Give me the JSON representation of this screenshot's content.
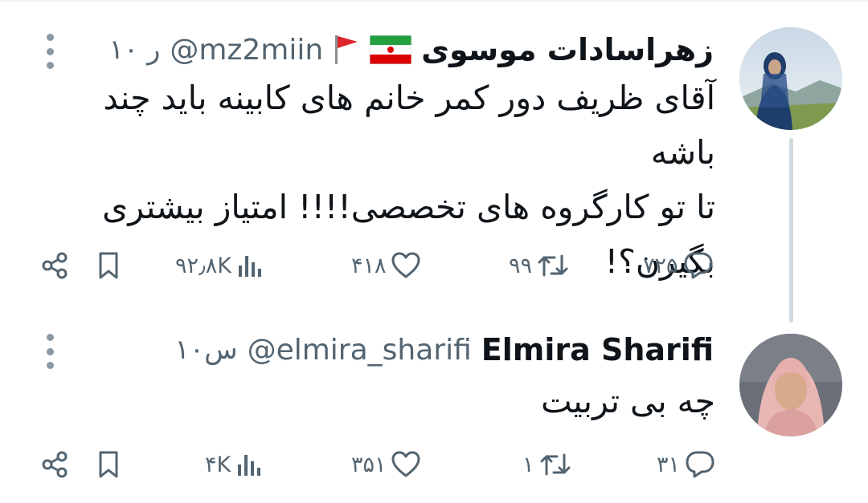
{
  "tweets": [
    {
      "author_name": "زهراسادات موسوی",
      "flag_icons": [
        "iran-flag-icon",
        "red-flag-icon"
      ],
      "handle": "@mz2miin",
      "time": "۱۰ ر",
      "text_lines": [
        "آقای ظریف دور کمر خانم های کابینه باید چند باشه",
        "تا تو کارگروه های تخصصی!!!! امتیاز بیشتری",
        "بگیرن؟!"
      ],
      "views": "۹۲٫۸K",
      "likes": "۴۱۸",
      "retweets": "۹۹",
      "replies": "۷۲۵"
    },
    {
      "author_name": "Elmira Sharifi",
      "handle": "@elmira_sharifi",
      "time": "۱۰س",
      "text_lines": [
        "چه بی تربیت"
      ],
      "views": "۴K",
      "likes": "۳۵۱",
      "retweets": "۱",
      "replies": "۳۱"
    }
  ],
  "colors": {
    "text": "#0f1419",
    "secondary": "#536471",
    "thread_line": "#cfd9de"
  }
}
